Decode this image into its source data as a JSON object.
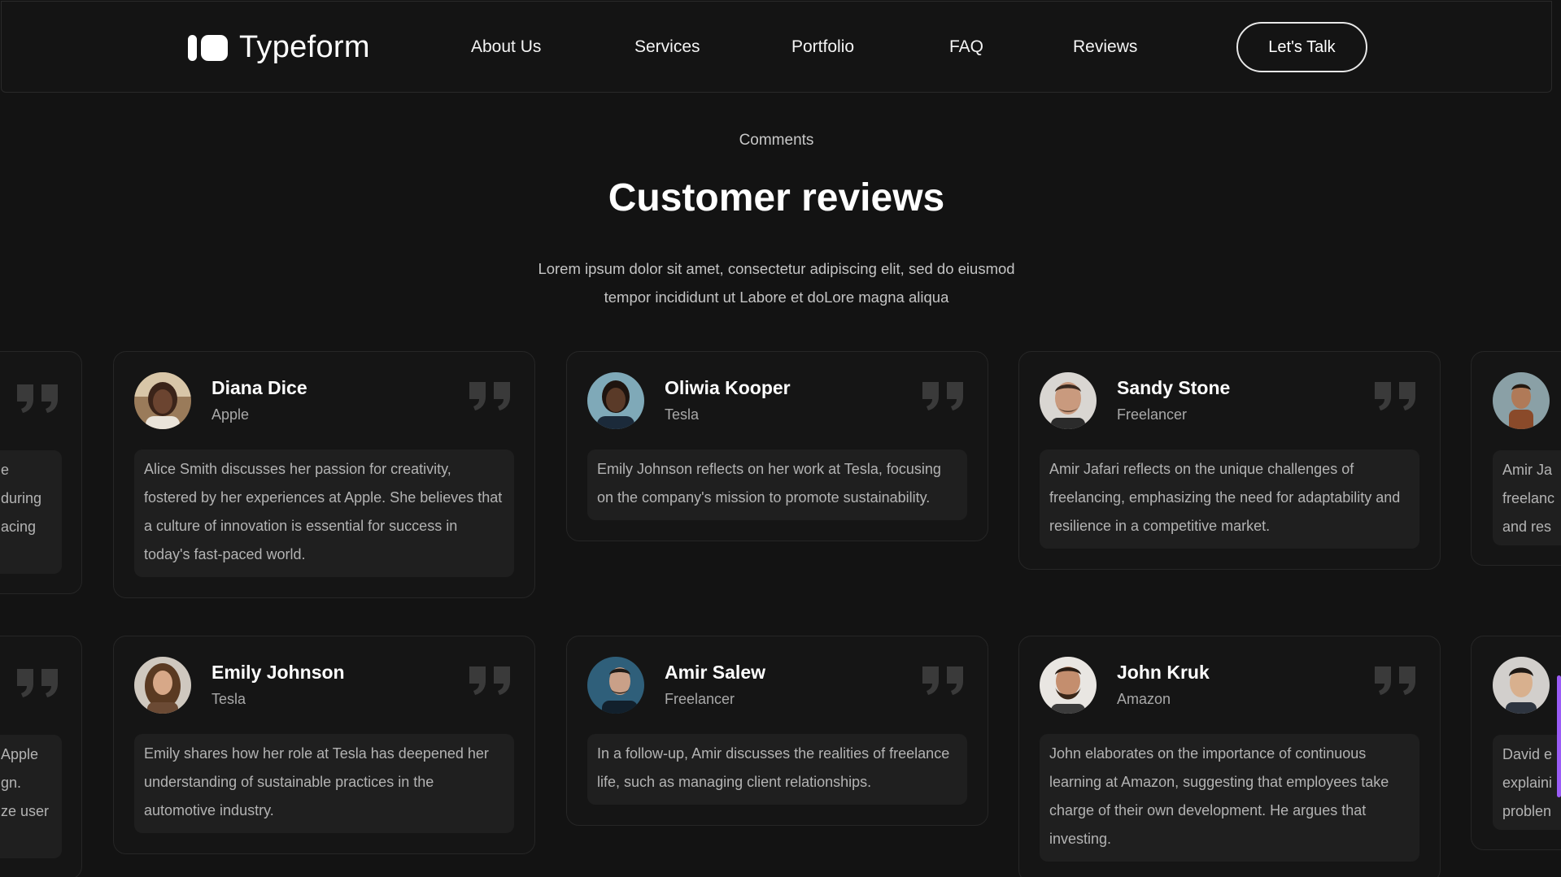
{
  "nav": {
    "brand": "Typeform",
    "links": [
      "About Us",
      "Services",
      "Portfolio",
      "FAQ",
      "Reviews"
    ],
    "cta": "Let's Talk"
  },
  "section": {
    "eyebrow": "Comments",
    "title": "Customer reviews",
    "lead": "Lorem ipsum dolor sit amet, consectetur adipiscing elit, sed do eiusmod tempor incididunt ut Labore et doLore magna aliqua"
  },
  "reviews": [
    {
      "name": "Diana Dice",
      "company": "Apple",
      "text": "Alice Smith discusses her passion for creativity, fostered by her experiences at Apple. She believes that a culture of innovation is essential for success in today's fast-paced world."
    },
    {
      "name": "Oliwia Kooper",
      "company": "Tesla",
      "text": "Emily Johnson reflects on her work at Tesla, focusing on the company's mission to promote sustainability."
    },
    {
      "name": "Sandy Stone",
      "company": "Freelancer",
      "text": "Amir Jafari reflects on the unique challenges of freelancing, emphasizing the need for adaptability and resilience in a competitive market."
    },
    {
      "name": "Emily Johnson",
      "company": "Tesla",
      "text": "Emily shares how her role at Tesla has deepened her understanding of sustainable practices in the automotive industry."
    },
    {
      "name": "Amir Salew",
      "company": "Freelancer",
      "text": "In a follow-up, Amir discusses the realities of freelance life, such as managing client relationships."
    },
    {
      "name": "John Kruk",
      "company": "Amazon",
      "text": "John elaborates on the importance of continuous learning at Amazon, suggesting that employees take charge of their own development. He argues that investing."
    }
  ],
  "edge_fragments": {
    "left_row1": [
      "e",
      "during",
      "acing"
    ],
    "left_row2": [
      "Apple",
      "gn.",
      "ze user"
    ],
    "right_row1": [
      "Amir Ja",
      "freelanc",
      "and res"
    ],
    "right_row2": [
      "David e",
      "explaini",
      "problen"
    ]
  },
  "colors": {
    "background": "#131313",
    "card": "#151515",
    "card_body": "#1f1f1f",
    "scroll_accent": "#9b5cf6"
  }
}
